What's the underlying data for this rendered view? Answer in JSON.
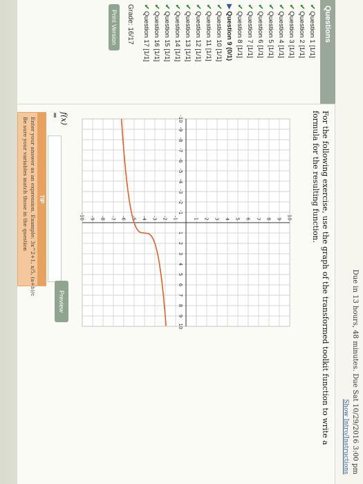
{
  "header": {
    "due_text": "Due in 13 hours, 48 minutes. Due Sat 10/29/2016 3:00 pm",
    "show_intro_link": "Show Intro/Instructions"
  },
  "sidebar": {
    "title": "Questions",
    "items": [
      {
        "label": "Question 1 [1/1]",
        "status": "correct"
      },
      {
        "label": "Question 2 [1/1]",
        "status": "correct"
      },
      {
        "label": "Question 3 [1/1]",
        "status": "correct"
      },
      {
        "label": "Question 4 [1/1]",
        "status": "correct"
      },
      {
        "label": "Question 5 [1/1]",
        "status": "correct"
      },
      {
        "label": "Question 6 [1/1]",
        "status": "correct"
      },
      {
        "label": "Question 7 [1/1]",
        "status": "correct"
      },
      {
        "label": "Question 8 [1/1]",
        "status": "correct"
      },
      {
        "label": "Question 9 (0/1)",
        "status": "current"
      },
      {
        "label": "Question 10 [1/1]",
        "status": "correct"
      },
      {
        "label": "Question 11 [1/1]",
        "status": "correct"
      },
      {
        "label": "Question 12 [1/1]",
        "status": "correct"
      },
      {
        "label": "Question 13 [1/1]",
        "status": "correct"
      },
      {
        "label": "Question 14 [1/1]",
        "status": "correct"
      },
      {
        "label": "Question 15 [1/1]",
        "status": "correct"
      },
      {
        "label": "Question 16 [1/1]",
        "status": "correct"
      },
      {
        "label": "Question 17 [1/1]",
        "status": "correct"
      }
    ],
    "grade_text": "Grade: 16/17",
    "print_button": "Print Version"
  },
  "question": {
    "prompt": "For the following exercise, use the graph of the transformed toolkit function to write a formula for the resulting function."
  },
  "graph": {
    "x_ticks": [
      "-10",
      "-9",
      "-8",
      "-7",
      "-6",
      "-5",
      "-4",
      "-3",
      "-2",
      "-1",
      "1",
      "2",
      "3",
      "4",
      "5",
      "6",
      "7",
      "8",
      "9",
      "10"
    ],
    "y_ticks": [
      "10",
      "9",
      "8",
      "7",
      "6",
      "5",
      "4",
      "3",
      "2",
      "1",
      "-1",
      "-2",
      "-3",
      "-4",
      "-5",
      "-6",
      "-7",
      "-8",
      "-9",
      "-10"
    ],
    "curve_color": "#e0602a"
  },
  "answer": {
    "label": "f(x) =",
    "value": "",
    "preview_button": "Preview"
  },
  "tip": {
    "title": "TIP",
    "line1": "Enter your answer as an expression. Example: 3x^2+1, x/5, (a+b)/c",
    "line2": "Be sure your variables match those in the question"
  }
}
